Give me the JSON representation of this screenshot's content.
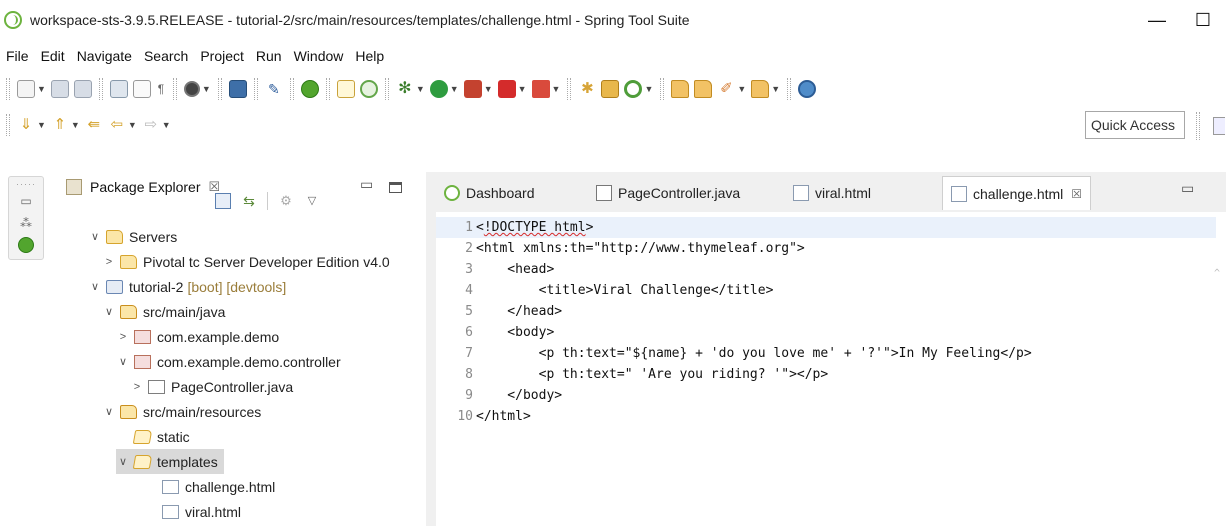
{
  "window": {
    "title": "workspace-sts-3.9.5.RELEASE - tutorial-2/src/main/resources/templates/challenge.html - Spring Tool Suite",
    "minimize": "—",
    "maximize": "☐"
  },
  "menu": [
    "File",
    "Edit",
    "Navigate",
    "Search",
    "Project",
    "Run",
    "Window",
    "Help"
  ],
  "toolbar": {
    "quick_access": "Quick Access"
  },
  "package_explorer": {
    "title": "Package Explorer",
    "close": "☒",
    "tree": [
      {
        "label": "Servers",
        "twisty": "∨",
        "tag": ""
      },
      {
        "label": "Pivotal tc Server Developer Edition v4.0",
        "twisty": ">",
        "tag": ""
      },
      {
        "label": "tutorial-2",
        "twisty": "∨",
        "tag": "[boot] [devtools]"
      },
      {
        "label": "src/main/java",
        "twisty": "∨",
        "tag": ""
      },
      {
        "label": "com.example.demo",
        "twisty": ">",
        "tag": ""
      },
      {
        "label": "com.example.demo.controller",
        "twisty": "∨",
        "tag": ""
      },
      {
        "label": "PageController.java",
        "twisty": ">",
        "tag": ""
      },
      {
        "label": "src/main/resources",
        "twisty": "∨",
        "tag": ""
      },
      {
        "label": "static",
        "twisty": "",
        "tag": ""
      },
      {
        "label": "templates",
        "twisty": "∨",
        "tag": ""
      },
      {
        "label": "challenge.html",
        "twisty": "",
        "tag": ""
      },
      {
        "label": "viral.html",
        "twisty": "",
        "tag": ""
      }
    ]
  },
  "editor": {
    "tabs": [
      {
        "label": "Dashboard",
        "icon": "spring-dashboard-icon"
      },
      {
        "label": "PageController.java",
        "icon": "java-file-icon"
      },
      {
        "label": "viral.html",
        "icon": "html-file-icon"
      },
      {
        "label": "challenge.html",
        "icon": "html-file-icon",
        "active": true
      }
    ],
    "active_close": "☒",
    "lines": [
      {
        "n": "1",
        "pre": "<",
        "err": "!DOCTYPE html",
        "post": ">"
      },
      {
        "n": "2",
        "pre": "<html xmlns:th=\"http://www.thymeleaf.org\">",
        "err": "",
        "post": ""
      },
      {
        "n": "3",
        "pre": "    <head>",
        "err": "",
        "post": ""
      },
      {
        "n": "4",
        "pre": "        <title>Viral Challenge</title>",
        "err": "",
        "post": ""
      },
      {
        "n": "5",
        "pre": "    </head>",
        "err": "",
        "post": ""
      },
      {
        "n": "6",
        "pre": "    <body>",
        "err": "",
        "post": ""
      },
      {
        "n": "7",
        "pre": "        <p th:text=\"${name} + 'do you love me' + '?'\">In My Feeling</p>",
        "err": "",
        "post": ""
      },
      {
        "n": "8",
        "pre": "        <p th:text=\" 'Are you riding? '\"></p>",
        "err": "",
        "post": ""
      },
      {
        "n": "9",
        "pre": "    </body>",
        "err": "",
        "post": ""
      },
      {
        "n": "10",
        "pre": "</html>",
        "err": "",
        "post": ""
      }
    ]
  }
}
